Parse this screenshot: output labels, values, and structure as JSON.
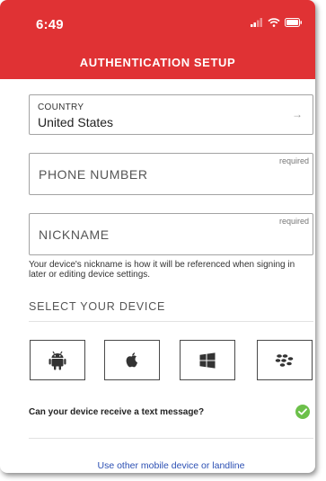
{
  "status_bar": {
    "time": "6:49"
  },
  "header": {
    "title": "AUTHENTICATION SETUP"
  },
  "country_field": {
    "label": "COUNTRY",
    "value": "United States",
    "arrow": "→"
  },
  "phone_field": {
    "placeholder": "PHONE NUMBER",
    "required": "required"
  },
  "nickname_field": {
    "placeholder": "NICKNAME",
    "required": "required"
  },
  "helper_text": "Your device's nickname is how it will be referenced when signing in later or editing device settings.",
  "device_section": {
    "title": "SELECT YOUR DEVICE",
    "devices": [
      {
        "icon": "android-icon"
      },
      {
        "icon": "apple-icon"
      },
      {
        "icon": "windows-icon"
      },
      {
        "icon": "blackberry-icon"
      }
    ]
  },
  "sms": {
    "question": "Can your device receive a text message?",
    "checked": true
  },
  "footer": {
    "link": "Use other mobile device or landline"
  },
  "colors": {
    "brand_red": "#e03234",
    "check_green": "#6cc04a",
    "link_blue": "#2b4fb3"
  }
}
